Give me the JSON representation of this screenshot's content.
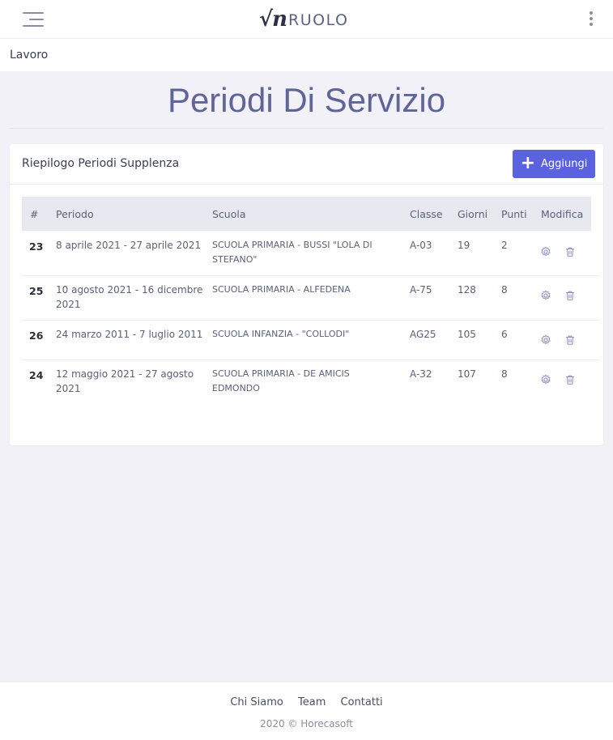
{
  "header": {
    "logo_mark": "√n",
    "logo_text": "RUOLO"
  },
  "subbar": {
    "label": "Lavoro"
  },
  "page": {
    "title": "Periodi Di Servizio"
  },
  "card": {
    "title": "Riepilogo Periodi Supplenza",
    "add_label": "Aggiungi",
    "accent": "#5b62e0"
  },
  "table": {
    "headers": {
      "id": "#",
      "periodo": "Periodo",
      "scuola": "Scuola",
      "classe": "Classe",
      "giorni": "Giorni",
      "punti": "Punti",
      "modifica": "Modifica"
    },
    "rows": [
      {
        "id": "23",
        "periodo_l1": "8 aprile 2021 - 27 aprile 2021",
        "periodo_l2": "",
        "scuola_l1": "SCUOLA PRIMARIA - BUSSI \"LOLA DI",
        "scuola_l2": "STEFANO\"",
        "classe": "A-03",
        "giorni": "19",
        "punti": "2"
      },
      {
        "id": "25",
        "periodo_l1": "10 agosto 2021 - 16 dicembre",
        "periodo_l2": "2021",
        "scuola_l1": "SCUOLA PRIMARIA - ALFEDENA",
        "scuola_l2": "",
        "classe": "A-75",
        "giorni": "128",
        "punti": "8"
      },
      {
        "id": "26",
        "periodo_l1": "24 marzo 2011 - 7 luglio 2011",
        "periodo_l2": "",
        "scuola_l1": "SCUOLA INFANZIA - \"COLLODI\"",
        "scuola_l2": "",
        "classe": "AG25",
        "giorni": "105",
        "punti": "6"
      },
      {
        "id": "24",
        "periodo_l1": "12 maggio 2021 - 27 agosto",
        "periodo_l2": "2021",
        "scuola_l1": "SCUOLA PRIMARIA - DE AMICIS",
        "scuola_l2": "EDMONDO",
        "classe": "A-32",
        "giorni": "107",
        "punti": "8"
      }
    ],
    "row_icons": [
      "gear-icon",
      "trash-icon"
    ]
  },
  "footer": {
    "links": [
      "Chi Siamo",
      "Team",
      "Contatti"
    ],
    "copyright": "2020 © Horecasoft"
  }
}
